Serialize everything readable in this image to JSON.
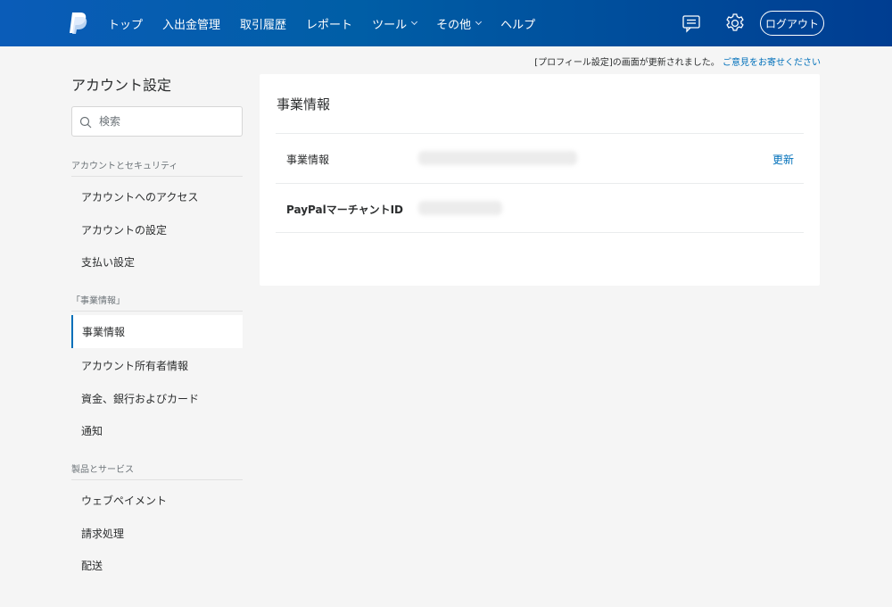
{
  "colors": {
    "nav_gradient_start": "#0a5cb8",
    "nav_gradient_end": "#003d91",
    "link": "#0070ba",
    "active_indicator": "#0070ba",
    "page_background": "#f5f5f5"
  },
  "header": {
    "logo_icon": "paypal-logo-icon",
    "nav": [
      {
        "label": "トップ",
        "has_dropdown": false
      },
      {
        "label": "入出金管理",
        "has_dropdown": false
      },
      {
        "label": "取引履歴",
        "has_dropdown": false
      },
      {
        "label": "レポート",
        "has_dropdown": false
      },
      {
        "label": "ツール",
        "has_dropdown": true
      },
      {
        "label": "その他",
        "has_dropdown": true
      },
      {
        "label": "ヘルプ",
        "has_dropdown": false
      }
    ],
    "messages_icon": "message-center-icon",
    "settings_icon": "gear-icon",
    "logout_label": "ログアウト"
  },
  "notice": {
    "text": "[プロフィール設定]の画面が更新されました。",
    "link": "ご意見をお寄せください"
  },
  "sidebar": {
    "title": "アカウント設定",
    "search_placeholder": "検索",
    "sections": [
      {
        "heading": "アカウントとセキュリティ",
        "items": [
          "アカウントへのアクセス",
          "アカウントの設定",
          "支払い設定"
        ]
      },
      {
        "heading": "「事業情報」",
        "items": [
          "事業情報",
          "アカウント所有者情報",
          "資金、銀行およびカード",
          "通知"
        ]
      },
      {
        "heading": "製品とサービス",
        "items": [
          "ウェブペイメント",
          "請求処理",
          "配送"
        ]
      }
    ],
    "active_item": "事業情報"
  },
  "main": {
    "title": "事業情報",
    "rows": [
      {
        "label": "事業情報",
        "value_hidden": true,
        "action": "更新"
      },
      {
        "label": "PayPalマーチャントID",
        "value_hidden": true,
        "action": ""
      }
    ]
  }
}
